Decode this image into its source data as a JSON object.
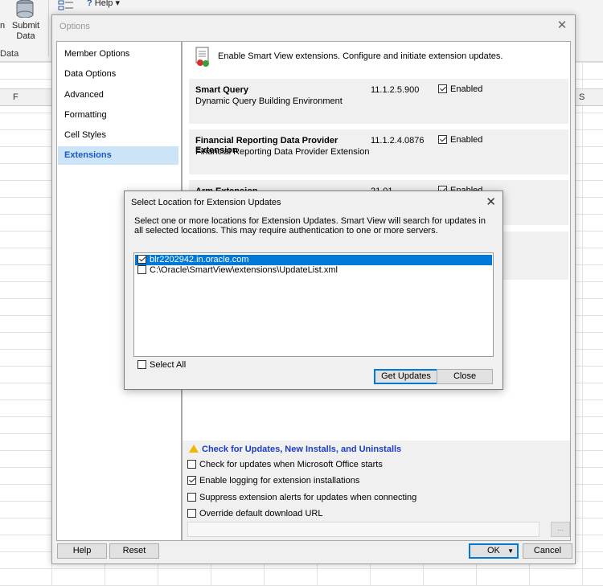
{
  "excel": {
    "ribbon": {
      "submit_label_1": "Submit",
      "submit_label_2": "Data",
      "left_fragment": "n",
      "group_label": "Data",
      "help_label": "Help"
    },
    "columns": [
      "F",
      "S"
    ]
  },
  "options": {
    "title": "Options",
    "nav": [
      {
        "label": "Member Options"
      },
      {
        "label": "Data Options"
      },
      {
        "label": "Advanced"
      },
      {
        "label": "Formatting"
      },
      {
        "label": "Cell Styles"
      },
      {
        "label": "Extensions"
      }
    ],
    "active_nav": "Extensions",
    "header_text": "Enable Smart View extensions. Configure and initiate extension updates.",
    "extensions": [
      {
        "name": "Smart Query",
        "description": "Dynamic Query Building Environment",
        "version": "11.1.2.5.900",
        "enabled_label": "Enabled",
        "enabled": true
      },
      {
        "name": "Financial Reporting Data Provider Extension",
        "description": "Financial Reporting Data Provider Extension",
        "version": "11.1.2.4.0876",
        "enabled_label": "Enabled",
        "enabled": true
      },
      {
        "name": "Arm Extension",
        "description": "",
        "version": "21.01",
        "enabled_label": "Enabled",
        "enabled": true
      }
    ],
    "updates": {
      "title": "Check for Updates, New Installs, and Uninstalls",
      "options": [
        {
          "label": "Check for updates when Microsoft Office starts",
          "checked": false
        },
        {
          "label": "Enable logging for extension installations",
          "checked": true
        },
        {
          "label": "Suppress extension alerts for updates when connecting",
          "checked": false
        },
        {
          "label": "Override default download URL",
          "checked": false
        }
      ],
      "url_button": "..."
    },
    "buttons": {
      "help": "Help",
      "reset": "Reset",
      "ok": "OK",
      "cancel": "Cancel"
    }
  },
  "select_dialog": {
    "title": "Select Location for Extension Updates",
    "description": "Select one or more locations for Extension Updates. Smart View will search for updates in all selected locations. This may require authentication to one or more servers.",
    "locations": [
      {
        "label": "blr2202942.in.oracle.com",
        "checked": true,
        "selected": true
      },
      {
        "label": "C:\\Oracle\\SmartView\\extensions\\UpdateList.xml",
        "checked": false,
        "selected": false
      }
    ],
    "select_all_label": "Select All",
    "get_updates_label": "Get Updates",
    "close_label": "Close"
  }
}
